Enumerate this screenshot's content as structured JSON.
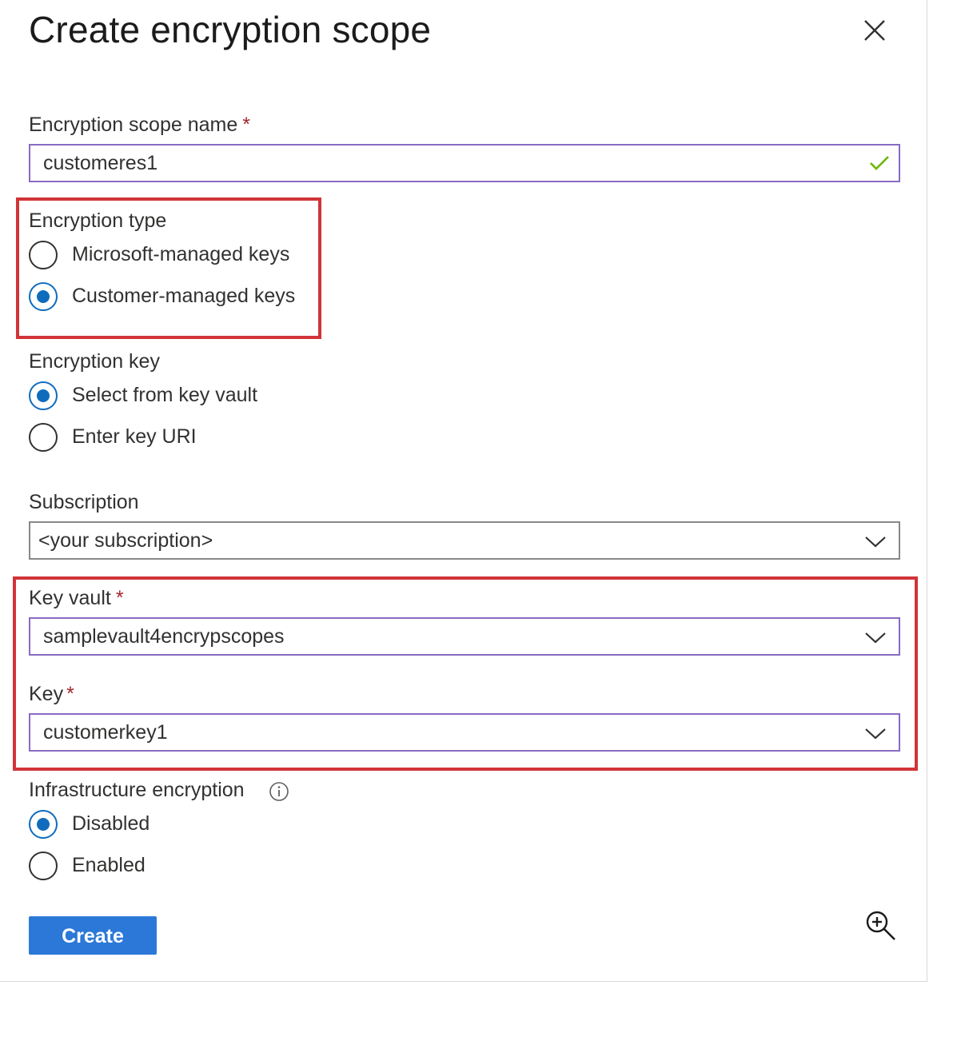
{
  "panel": {
    "title": "Create encryption scope",
    "close_icon": "close-icon"
  },
  "scope_name": {
    "label": "Encryption scope name",
    "required_mark": "*",
    "value": "customeres1",
    "valid_icon": "checkmark-icon"
  },
  "encryption_type": {
    "label": "Encryption type",
    "options": [
      {
        "label": "Microsoft-managed keys",
        "selected": false
      },
      {
        "label": "Customer-managed keys",
        "selected": true
      }
    ]
  },
  "encryption_key": {
    "label": "Encryption key",
    "options": [
      {
        "label": "Select from key vault",
        "selected": true
      },
      {
        "label": "Enter key URI",
        "selected": false
      }
    ]
  },
  "subscription": {
    "label": "Subscription",
    "value": "<your subscription>"
  },
  "key_vault": {
    "label": "Key vault",
    "required_mark": "*",
    "value": "samplevault4encrypscopes"
  },
  "key": {
    "label": "Key",
    "required_mark": "*",
    "value": "customerkey1"
  },
  "infrastructure_encryption": {
    "label": "Infrastructure encryption",
    "info_icon": "info-icon",
    "options": [
      {
        "label": "Disabled",
        "selected": true
      },
      {
        "label": "Enabled",
        "selected": false
      }
    ]
  },
  "actions": {
    "create_label": "Create",
    "zoom_icon": "zoom-in-icon"
  },
  "colors": {
    "accent": "#0f6cbd",
    "button": "#2c78d8",
    "focus_border": "#8a6ac4",
    "highlight": "#d13438",
    "required": "#a4262c",
    "valid": "#6bb700"
  }
}
